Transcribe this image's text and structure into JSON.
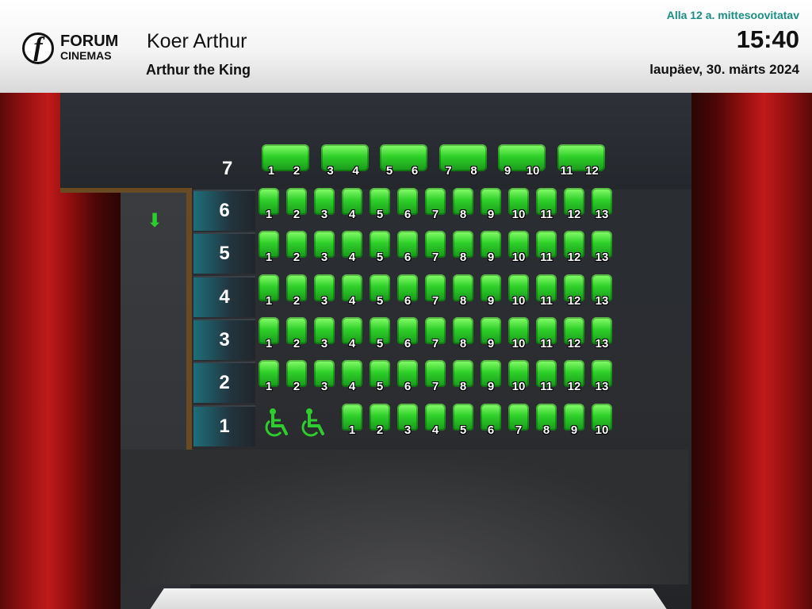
{
  "header": {
    "logo_word1": "FORUM",
    "logo_word2": "CINEMAS",
    "logo_letter": "f",
    "movie_title": "Koer Arthur",
    "movie_subtitle": "Arthur the King",
    "age_rating": "Alla 12 a. mittesoovitatav",
    "time": "15:40",
    "date": "laupäev, 30. märts 2024"
  },
  "hall": {
    "exit_icon": "down-arrow-icon",
    "accent_color": "#2ecc2e",
    "rows": [
      {
        "label": "7",
        "seats": [
          "1",
          "2",
          "3",
          "4",
          "5",
          "6",
          "7",
          "8",
          "9",
          "10",
          "11",
          "12"
        ],
        "type": "pairs"
      },
      {
        "label": "6",
        "seats": [
          "1",
          "2",
          "3",
          "4",
          "5",
          "6",
          "7",
          "8",
          "9",
          "10",
          "11",
          "12",
          "13"
        ]
      },
      {
        "label": "5",
        "seats": [
          "1",
          "2",
          "3",
          "4",
          "5",
          "6",
          "7",
          "8",
          "9",
          "10",
          "11",
          "12",
          "13"
        ]
      },
      {
        "label": "4",
        "seats": [
          "1",
          "2",
          "3",
          "4",
          "5",
          "6",
          "7",
          "8",
          "9",
          "10",
          "11",
          "12",
          "13"
        ]
      },
      {
        "label": "3",
        "seats": [
          "1",
          "2",
          "3",
          "4",
          "5",
          "6",
          "7",
          "8",
          "9",
          "10",
          "11",
          "12",
          "13"
        ]
      },
      {
        "label": "2",
        "seats": [
          "1",
          "2",
          "3",
          "4",
          "5",
          "6",
          "7",
          "8",
          "9",
          "10",
          "11",
          "12",
          "13"
        ]
      },
      {
        "label": "1",
        "seats": [
          "1",
          "2",
          "3",
          "4",
          "5",
          "6",
          "7",
          "8",
          "9",
          "10"
        ],
        "wheelchair_spaces": 2
      }
    ]
  }
}
